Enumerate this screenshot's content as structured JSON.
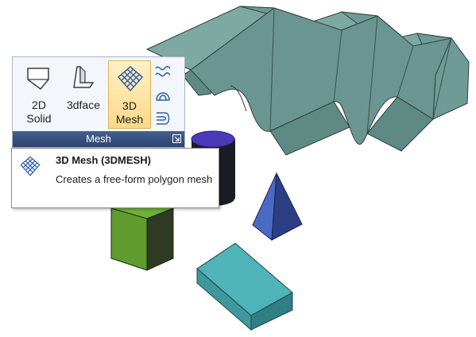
{
  "ribbon": {
    "buttons": [
      {
        "id": "2d-solid",
        "label": "2D\nSolid",
        "icon": "2d-solid-icon"
      },
      {
        "id": "3dface",
        "label": "3dface",
        "icon": "3dface-icon"
      },
      {
        "id": "3d-mesh",
        "label": "3D\nMesh",
        "icon": "3d-mesh-icon",
        "active": true
      }
    ],
    "small_buttons": [
      "ruled-surface-icon",
      "revolved-surface-icon",
      "edge-surface-icon"
    ],
    "panel_title": "Mesh",
    "launcher_icon": "dialog-launcher-icon"
  },
  "tooltip": {
    "title": "3D Mesh (3DMESH)",
    "description": "Creates a free-form polygon mesh",
    "icon": "3d-mesh-icon"
  },
  "colors": {
    "ribbon_bg": "#f3f6fa",
    "panel_bar": "#34507f",
    "active_button": "#fbd98a",
    "mesh_surface": "#6f9b96",
    "cylinder": "#4b3ab8",
    "cube": "#5f9b2f",
    "pyramid": "#4c69c4",
    "wedge": "#4fb3b8"
  }
}
